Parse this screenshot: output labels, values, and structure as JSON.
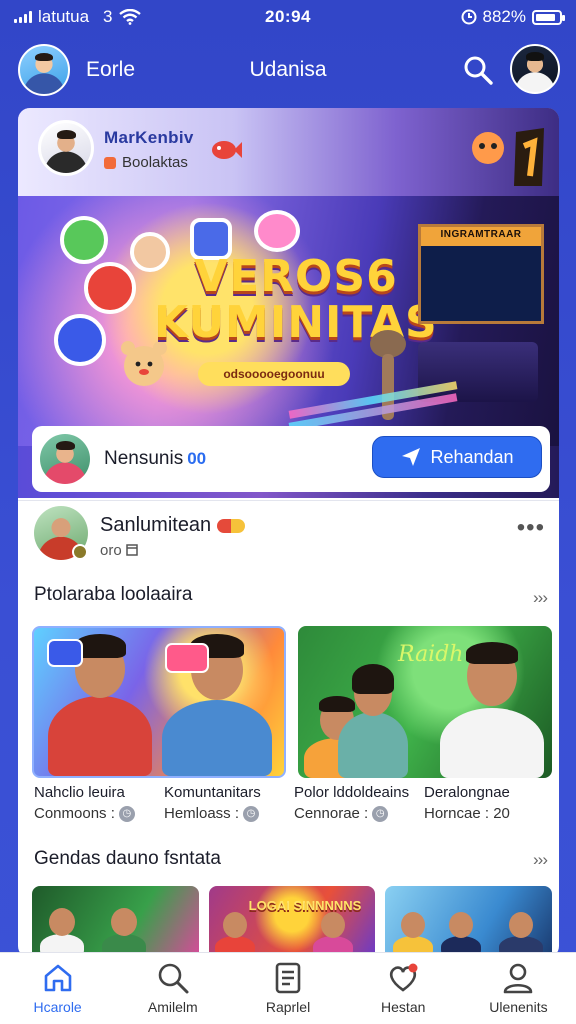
{
  "status_bar": {
    "carrier": "latutua",
    "network": "3",
    "time": "20:94",
    "battery_text": "882%",
    "battery_level": 0.88
  },
  "header": {
    "left_title": "Eorle",
    "title": "Udanisa",
    "search_icon": "search-icon"
  },
  "feature": {
    "name": "MarKenbiv",
    "subtitle": "Boolaktas",
    "banner": {
      "title_line1": "VEROS6",
      "title_line2": "KUMINITAS",
      "tagline": "odsooooegoonuu",
      "screen_title": "INGRAMTRAAR"
    }
  },
  "follow_row": {
    "name": "Nensunis",
    "badge": "00",
    "button_label": "Rehandan",
    "button_icon": "send-icon"
  },
  "post": {
    "author": "Sanlumitean",
    "meta": "oro",
    "more_label": "•••"
  },
  "section1": {
    "title": "Ptolaraba loolaaira",
    "more_label": "›››",
    "thumb_sign": "Raidh",
    "items": [
      {
        "title": "Nahclio leuira",
        "stat_label": "Conmoons :"
      },
      {
        "title": "Komuntanitars",
        "stat_label": "Hemloass :"
      },
      {
        "title": "Polor lddoldeains",
        "stat_label": "Cennorae :"
      },
      {
        "title": "Deralongnae",
        "stat_label": "Horncae : 20"
      }
    ]
  },
  "section2": {
    "title": "Gendas dauno fsntata",
    "more_label": "›››",
    "thumb_sign": "LOGAI SINNNNNS"
  },
  "bottom_nav": [
    {
      "label": "Hcarole",
      "icon": "home-icon",
      "active": true
    },
    {
      "label": "Amilelm",
      "icon": "search-icon",
      "active": false
    },
    {
      "label": "Raprlel",
      "icon": "document-icon",
      "active": false
    },
    {
      "label": "Hestan",
      "icon": "heart-icon",
      "active": false
    },
    {
      "label": "Ulenenits",
      "icon": "user-icon",
      "active": false
    }
  ],
  "colors": {
    "brand_blue": "#3a4fd4",
    "accent": "#2f6cf0",
    "banner_gold": "#ffd33a"
  }
}
